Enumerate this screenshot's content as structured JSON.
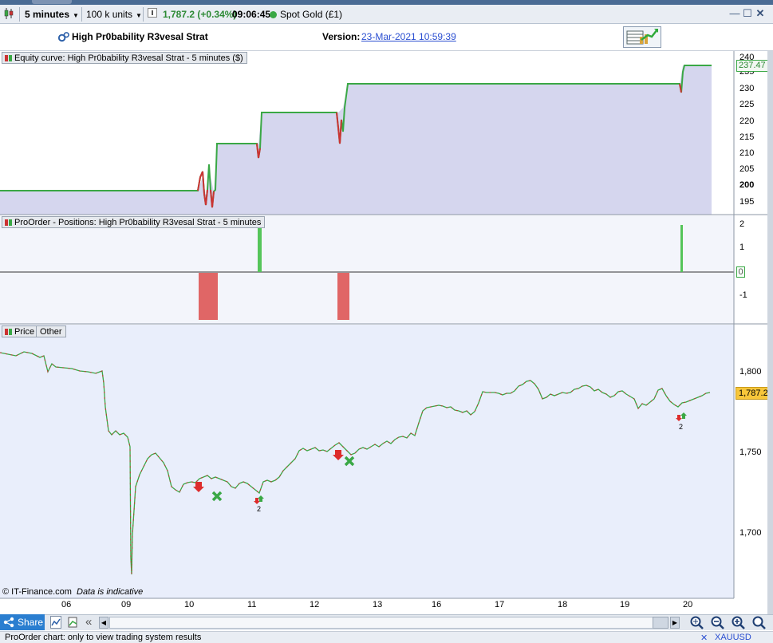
{
  "toolbar": {
    "timeframe": "5 minutes",
    "units": "100 k units",
    "price": "1,787.2",
    "change": "(+0.34%)",
    "time": "09:06:45",
    "instrument": "Spot Gold (£1)"
  },
  "strategy": {
    "name": "High Pr0bability R3vesal Strat",
    "version_label": "Version:",
    "version_value": "23-Mar-2021 10:59:39"
  },
  "equity_panel": {
    "label": "Equity curve: High Pr0bability R3vesal Strat - 5 minutes ($)",
    "last_value": "237.47",
    "ticks": [
      "240",
      "235",
      "230",
      "225",
      "220",
      "215",
      "210",
      "205",
      "200",
      "195"
    ],
    "bold_tick": "200",
    "color_line": "#3aa845",
    "color_loss": "#cc3333",
    "color_fill": "#d5d6ee"
  },
  "positions_panel": {
    "label": "ProOrder - Positions: High Pr0bability R3vesal Strat - 5 minutes",
    "ticks": [
      "2",
      "1",
      "0",
      "-1"
    ],
    "color_long": "#55c55a",
    "color_short": "#e06666"
  },
  "price_panel": {
    "tab_price": "Price",
    "tab_other": "Other",
    "ticks": [
      "1,800",
      "1,750",
      "1,700"
    ],
    "last_price": "1,787.2",
    "copyright": "© IT-Finance.com",
    "indicative": "Data is indicative",
    "marker_count_1": "2",
    "marker_count_2": "2",
    "color_up": "#3aa845",
    "color_down": "#cc3333",
    "color_bg": "#e9eefb"
  },
  "xaxis": {
    "labels": [
      "06",
      "09",
      "10",
      "11",
      "12",
      "13",
      "16",
      "17",
      "18",
      "19",
      "20"
    ]
  },
  "bottom": {
    "share": "Share",
    "status": "ProOrder chart: only to view trading system results",
    "symbol": "XAUUSD"
  }
}
